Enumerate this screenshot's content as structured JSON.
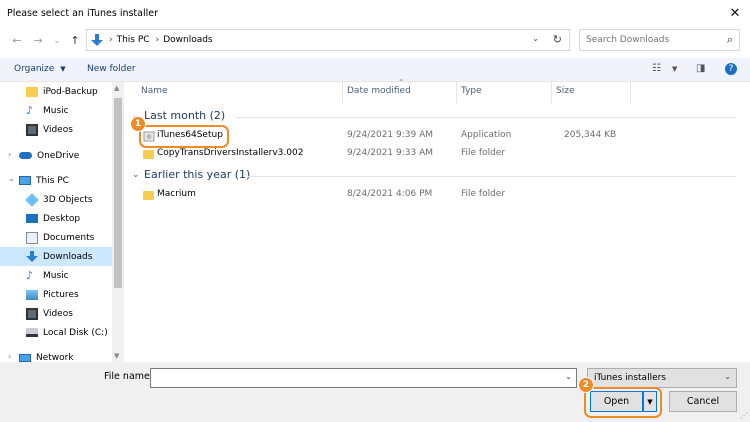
{
  "window": {
    "title": "Please select an iTunes installer"
  },
  "address": {
    "crumbs": [
      "This PC",
      "Downloads"
    ],
    "search_placeholder": "Search Downloads"
  },
  "toolbar": {
    "organize": "Organize",
    "new_folder": "New folder"
  },
  "nav": {
    "items": [
      {
        "label": "iPod-Backup",
        "icon": "folder-icon"
      },
      {
        "label": "Music",
        "icon": "music-icon"
      },
      {
        "label": "Videos",
        "icon": "videos-icon"
      },
      {
        "label": "OneDrive",
        "icon": "onedrive-icon"
      },
      {
        "label": "This PC",
        "icon": "pc-icon"
      },
      {
        "label": "3D Objects",
        "icon": "3d-objects-icon"
      },
      {
        "label": "Desktop",
        "icon": "desktop-icon"
      },
      {
        "label": "Documents",
        "icon": "documents-icon"
      },
      {
        "label": "Downloads",
        "icon": "downloads-icon"
      },
      {
        "label": "Music",
        "icon": "music-icon"
      },
      {
        "label": "Pictures",
        "icon": "pictures-icon"
      },
      {
        "label": "Videos",
        "icon": "videos-icon"
      },
      {
        "label": "Local Disk (C:)",
        "icon": "disk-icon"
      },
      {
        "label": "Network",
        "icon": "network-icon"
      }
    ],
    "selected": "Downloads"
  },
  "columns": {
    "name": "Name",
    "date": "Date modified",
    "type": "Type",
    "size": "Size"
  },
  "groups": [
    {
      "title": "Last month (2)",
      "rows": [
        {
          "name": "iTunes64Setup",
          "date": "9/24/2021 9:39 AM",
          "type": "Application",
          "size": "205,344 KB"
        },
        {
          "name": "CopyTransDriversInstallerv3.002",
          "date": "9/24/2021 9:33 AM",
          "type": "File folder",
          "size": ""
        }
      ]
    },
    {
      "title": "Earlier this year (1)",
      "rows": [
        {
          "name": "Macrium",
          "date": "8/24/2021 4:06 PM",
          "type": "File folder",
          "size": ""
        }
      ]
    }
  ],
  "bottom": {
    "file_name_label": "File name:",
    "file_name_value": "",
    "filter": "iTunes installers",
    "open": "Open",
    "cancel": "Cancel"
  },
  "badges": [
    "1",
    "2"
  ],
  "colors": {
    "accent": "#0078d7",
    "highlight": "#f08a24",
    "selected": "#cce8ff",
    "folder": "#f7cd50"
  }
}
